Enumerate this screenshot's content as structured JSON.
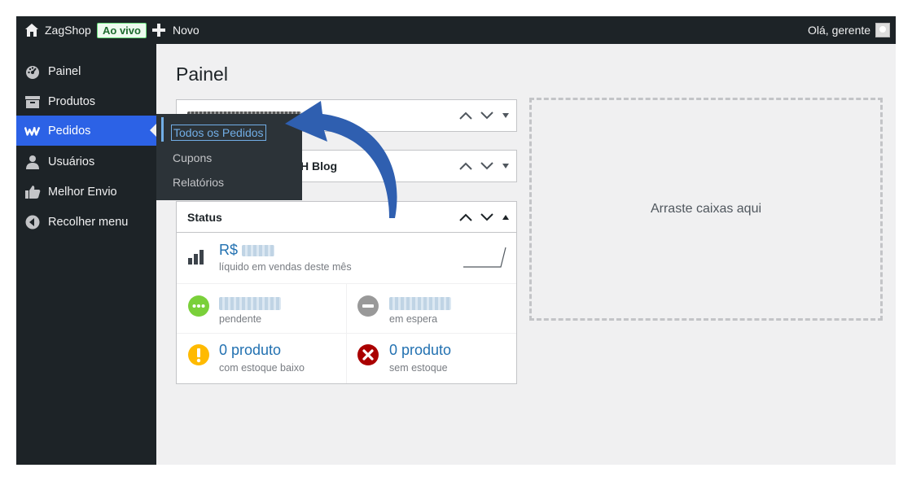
{
  "adminbar": {
    "site_name": "ZagShop",
    "live_badge": "Ao vivo",
    "new_label": "Novo",
    "greeting": "Olá, gerente"
  },
  "sidebar": {
    "items": [
      {
        "label": "Painel",
        "icon": "dashboard-icon"
      },
      {
        "label": "Produtos",
        "icon": "archive-icon"
      },
      {
        "label": "Pedidos",
        "icon": "woo-icon"
      },
      {
        "label": "Usuários",
        "icon": "user-icon"
      },
      {
        "label": "Melhor Envio",
        "icon": "thumbs-up-icon"
      },
      {
        "label": "Recolher menu",
        "icon": "collapse-icon"
      }
    ]
  },
  "flyout": {
    "items": [
      "Todos os Pedidos",
      "Cupons",
      "Relatórios"
    ]
  },
  "main": {
    "title": "Painel",
    "widget2_title_fragment": "H Blog",
    "status": {
      "title": "Status",
      "sales_prefix": "R$",
      "sales_caption": "líquido em vendas deste mês",
      "pending_caption": "pendente",
      "onhold_caption": "em espera",
      "lowstock_value": "0 produto",
      "lowstock_caption": "com estoque baixo",
      "outstock_value": "0 produto",
      "outstock_caption": "sem estoque"
    },
    "drop_zone": "Arraste caixas aqui"
  },
  "colors": {
    "accent": "#2c62e6",
    "link": "#2271b1",
    "sidebar": "#1d2327",
    "arrow": "#2f5fb0"
  }
}
